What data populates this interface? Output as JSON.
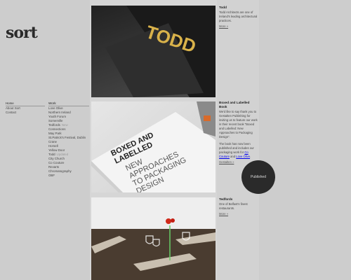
{
  "site": {
    "logo": "sort"
  },
  "nav": {
    "items": [
      "Home",
      "About Sort",
      "Contact"
    ]
  },
  "work": {
    "heading": "Work",
    "items": [
      {
        "label": "Love Olive"
      },
      {
        "label": "Northern Ireland"
      },
      {
        "label": "Youth Forum"
      },
      {
        "label": "Somerville"
      },
      {
        "label": "Tedfords",
        "tag": "New"
      },
      {
        "label": "Connections"
      },
      {
        "label": "May Park"
      },
      {
        "label": "St.Patrick's Festival, Dublin"
      },
      {
        "label": "Crane"
      },
      {
        "label": "Horsell"
      },
      {
        "label": "Yellow Door"
      },
      {
        "label": "Todd",
        "tag": "Updated"
      },
      {
        "label": "City Church"
      },
      {
        "label": "Co Couture"
      },
      {
        "label": "Revarts"
      },
      {
        "label": "Chromatography"
      },
      {
        "label": "OBF"
      }
    ]
  },
  "photos": {
    "todd": {
      "text": "TODD"
    },
    "book": {
      "line1": "BOXED AND",
      "line2": "LABELLED",
      "line3": "NEW",
      "line4": "APPROACHES",
      "line5": "TO PACKAGING",
      "line6": "DESIGN"
    }
  },
  "posts": {
    "todd": {
      "title": "Todd",
      "body": "Todd Architects are one of Ireland's leading architectural practices.",
      "more": "More »"
    },
    "boxed": {
      "title": "Boxed and Labelled Book",
      "body1": "We'd like to say thank you to Gestalten Publishing for inviting us to feature our work in their recent book \"Boxed and Labelled: New Approaches to Packaging Design\".",
      "body2": "The book has now been published and includes our packaging work for",
      "link1": "Co Couture",
      "and": "and",
      "link2": "Love Olive",
      "end": ".",
      "more": "Gestalten »"
    },
    "tedfords": {
      "title": "Tedfords",
      "body": "One of Belfast's finest restaurants.",
      "more": "More »"
    }
  },
  "badge": {
    "label": "Published"
  },
  "colors": {
    "background": "#cdcdcd",
    "badge": "#2a2a2a",
    "accent_gold": "#d9b24a"
  }
}
